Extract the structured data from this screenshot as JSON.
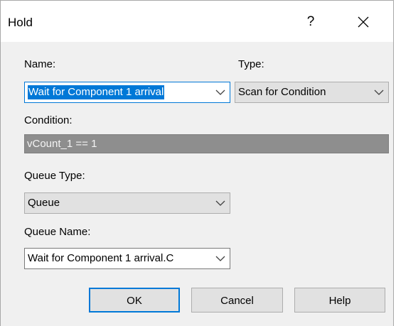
{
  "window": {
    "title": "Hold",
    "help_glyph": "?",
    "close_icon": "close-icon"
  },
  "form": {
    "name_label": "Name:",
    "name_value": "Wait for Component 1 arrival",
    "type_label": "Type:",
    "type_value": "Scan for Condition",
    "condition_label": "Condition:",
    "condition_value": "vCount_1 == 1",
    "queue_type_label": "Queue Type:",
    "queue_type_value": "Queue",
    "queue_name_label": "Queue Name:",
    "queue_name_value": "Wait for Component 1 arrival.C"
  },
  "buttons": {
    "ok": "OK",
    "cancel": "Cancel",
    "help": "Help"
  },
  "colors": {
    "accent": "#0078d7",
    "dialog_bg": "#f0f0f0",
    "disabled_field_bg": "#8e8e8e"
  },
  "icons": {
    "dropdown": "chevron-down-icon",
    "close": "close-icon"
  }
}
